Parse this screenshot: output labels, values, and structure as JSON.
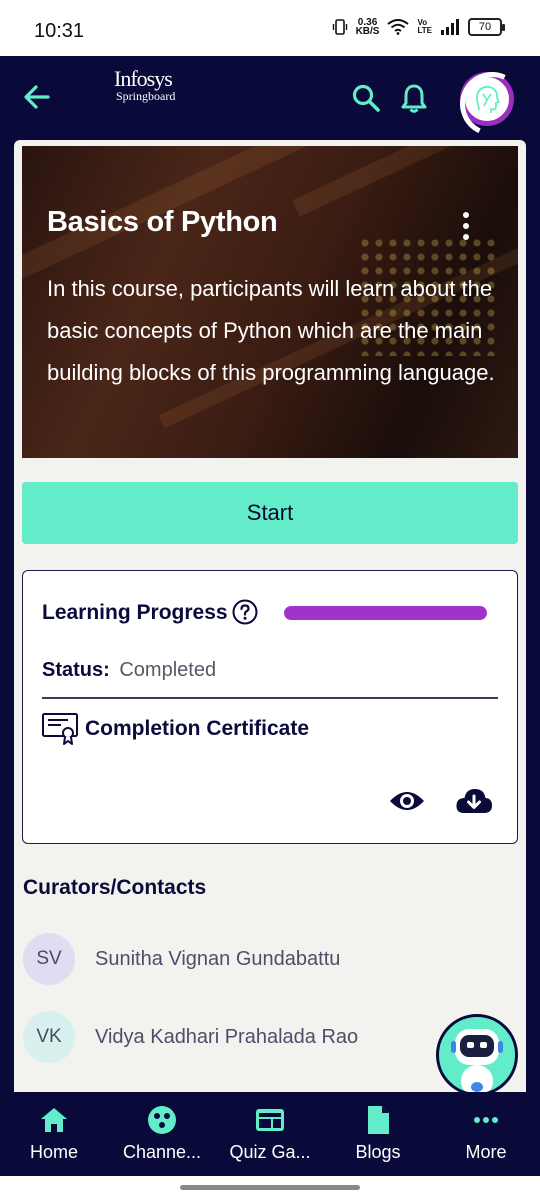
{
  "status_bar": {
    "time": "10:31",
    "net_speed_value": "0.36",
    "net_speed_unit": "KB/S",
    "volte_top": "Vo",
    "volte_bottom": "LTE",
    "battery": "70"
  },
  "header": {
    "logo_line1": "Infosys",
    "logo_line2": "Springboard",
    "accent_color": "#63ecc9",
    "background_color": "#0a0a3a"
  },
  "course": {
    "title": "Basics of Python",
    "description": "In this course, participants will learn about the basic concepts of Python which are the main building blocks of this programming language."
  },
  "start_button": {
    "label": "Start"
  },
  "progress_card": {
    "label": "Learning Progress",
    "progress_percent": 100,
    "progress_color": "#a033c8",
    "status_key": "Status:",
    "status_value": "Completed",
    "certificate_label": "Completion Certificate"
  },
  "curators": {
    "title": "Curators/Contacts",
    "contacts": [
      {
        "initials": "SV",
        "name": "Sunitha Vignan Gundabattu",
        "color": "#e0dcf2"
      },
      {
        "initials": "VK",
        "name": "Vidya Kadhari Prahalada Rao",
        "color": "#d8f1ee"
      }
    ]
  },
  "bottom_nav": [
    {
      "label": "Home",
      "icon": "home-icon"
    },
    {
      "label": "Channe...",
      "icon": "channels-icon"
    },
    {
      "label": "Quiz Ga...",
      "icon": "quiz-icon"
    },
    {
      "label": "Blogs",
      "icon": "blogs-icon"
    },
    {
      "label": "More",
      "icon": "more-icon"
    }
  ]
}
